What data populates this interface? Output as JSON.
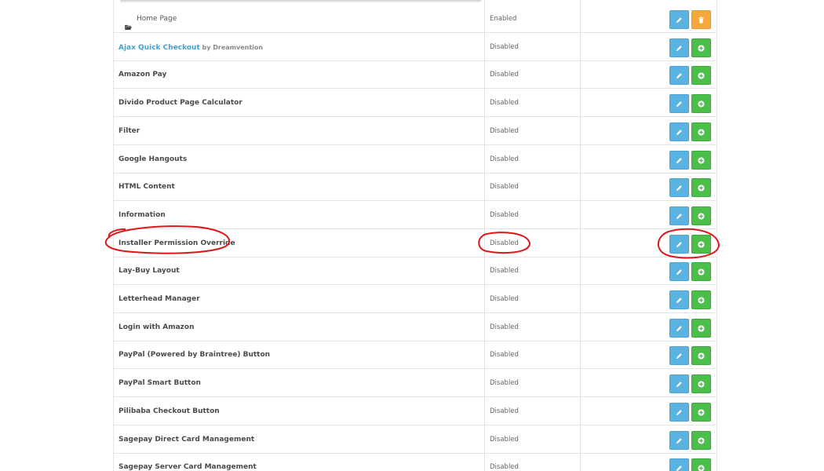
{
  "extensions": [
    {
      "name": "Home Page",
      "status": "Enabled",
      "child": true,
      "action": "uninstall"
    },
    {
      "name": "Ajax Quick Checkout",
      "author_prefix": "by",
      "author": "Dreamvention",
      "status": "Disabled",
      "link": true,
      "action": "install"
    },
    {
      "name": "Amazon Pay",
      "status": "Disabled",
      "action": "install"
    },
    {
      "name": "Divido Product Page Calculator",
      "status": "Disabled",
      "action": "install"
    },
    {
      "name": "Filter",
      "status": "Disabled",
      "action": "install"
    },
    {
      "name": "Google Hangouts",
      "status": "Disabled",
      "action": "install"
    },
    {
      "name": "HTML Content",
      "status": "Disabled",
      "action": "install"
    },
    {
      "name": "Information",
      "status": "Disabled",
      "action": "install"
    },
    {
      "name": "Installer Permission Override",
      "status": "Disabled",
      "action": "install",
      "highlighted": true
    },
    {
      "name": "Lay-Buy Layout",
      "status": "Disabled",
      "action": "install"
    },
    {
      "name": "Letterhead Manager",
      "status": "Disabled",
      "action": "install"
    },
    {
      "name": "Login with Amazon",
      "status": "Disabled",
      "action": "install"
    },
    {
      "name": "PayPal (Powered by Braintree) Button",
      "status": "Disabled",
      "action": "install"
    },
    {
      "name": "PayPal Smart Button",
      "status": "Disabled",
      "action": "install"
    },
    {
      "name": "Pilibaba Checkout Button",
      "status": "Disabled",
      "action": "install"
    },
    {
      "name": "Sagepay Direct Card Management",
      "status": "Disabled",
      "action": "install"
    },
    {
      "name": "Sagepay Server Card Management",
      "status": "Disabled",
      "action": "install"
    }
  ],
  "icons": {
    "edit": "pencil-icon",
    "install": "plus-circle-icon",
    "uninstall": "trash-icon",
    "folder": "folder-open-icon"
  },
  "colors": {
    "edit_button": "#5bb3e1",
    "install_button": "#4bbf49",
    "uninstall_button": "#f5a83b",
    "link": "#3fa3d6",
    "annotation": "#d9191c"
  }
}
